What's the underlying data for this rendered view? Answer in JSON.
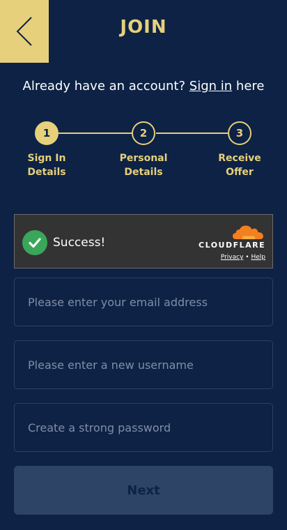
{
  "header": {
    "title": "JOIN",
    "back_icon": "chevron-left-icon"
  },
  "signin": {
    "prefix": "Already have an account?",
    "link": "Sign in",
    "suffix": "here"
  },
  "steps": [
    {
      "number": "1",
      "line1": "Sign In",
      "line2": "Details",
      "active": true
    },
    {
      "number": "2",
      "line1": "Personal",
      "line2": "Details",
      "active": false
    },
    {
      "number": "3",
      "line1": "Receive",
      "line2": "Offer",
      "active": false
    }
  ],
  "captcha": {
    "status": "Success!",
    "brand": "CLOUDFLARE",
    "privacy": "Privacy",
    "separator": "•",
    "help": "Help"
  },
  "form": {
    "email_placeholder": "Please enter your email address",
    "username_placeholder": "Please enter a new username",
    "password_placeholder": "Create a strong password",
    "next_label": "Next"
  },
  "colors": {
    "background": "#0d2244",
    "accent": "#e6d07c",
    "success": "#3aa65a",
    "cloudflare_orange": "#f38020"
  }
}
